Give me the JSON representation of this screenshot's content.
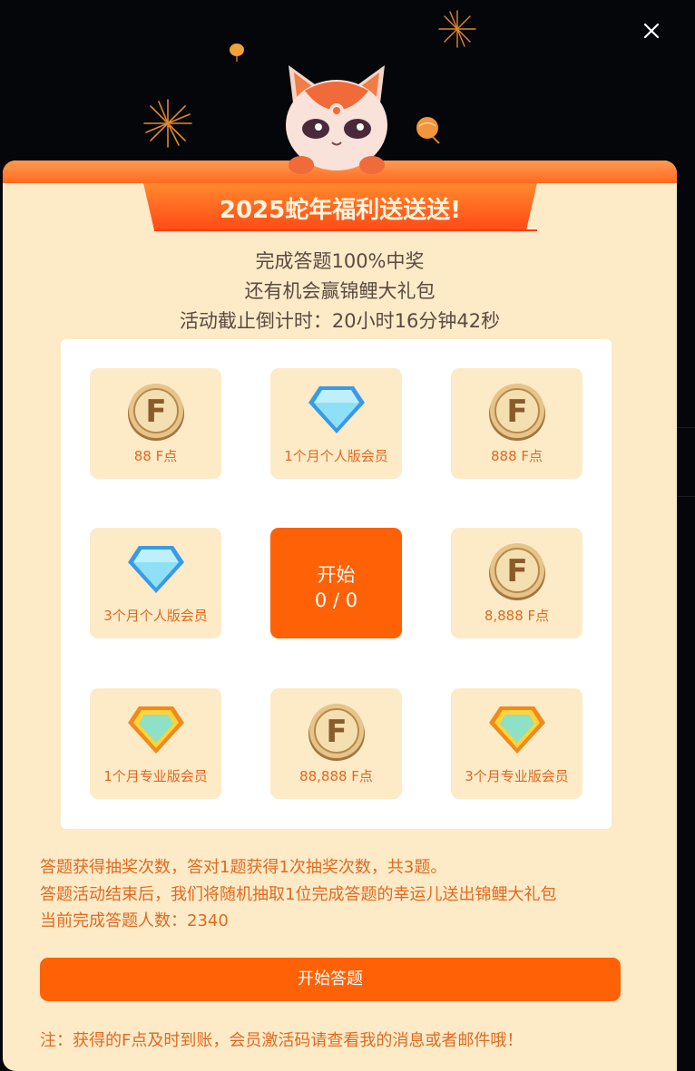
{
  "banner": {
    "title": "2025蛇年福利送送送!"
  },
  "intro": {
    "line1": "完成答题100%中奖",
    "line2": "还有机会赢锦鲤大礼包",
    "countdown": "活动截止倒计时：20小时16分钟42秒"
  },
  "prizes": [
    {
      "label": "88 F点",
      "icon": "coin-icon"
    },
    {
      "label": "1个月个人版会员",
      "icon": "blue-diamond-icon"
    },
    {
      "label": "888 F点",
      "icon": "coin-icon"
    },
    {
      "label": "3个月个人版会员",
      "icon": "blue-diamond-icon"
    },
    {
      "label": "8,888 F点",
      "icon": "coin-icon"
    },
    {
      "label": "1个月专业版会员",
      "icon": "gold-diamond-icon"
    },
    {
      "label": "88,888 F点",
      "icon": "coin-icon"
    },
    {
      "label": "3个月专业版会员",
      "icon": "gold-diamond-icon"
    }
  ],
  "start": {
    "label": "开始",
    "count": "0 / 0"
  },
  "rules": {
    "line1": "答题获得抽奖次数，答对1题获得1次抽奖次数，共3题。",
    "line2": "答题活动结束后，我们将随机抽取1位完成答题的幸运儿送出锦鲤大礼包",
    "line3": "当前完成答题人数：2340"
  },
  "button": {
    "label": "开始答题"
  },
  "note": "注：获得的F点及时到账，会员激活码请查看我的消息或者邮件哦！",
  "colors": {
    "accent": "#fe6106",
    "panel": "#fdebc8",
    "label": "#e2691f"
  }
}
